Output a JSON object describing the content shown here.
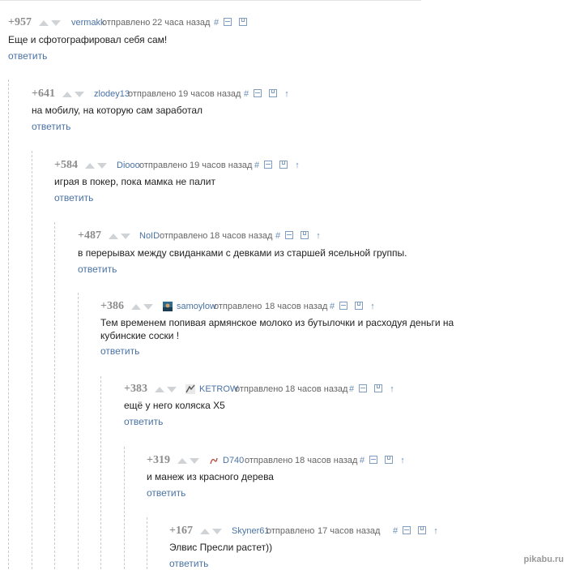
{
  "comments": [
    {
      "rating": "+957",
      "author": "vermakk",
      "sent": "отправлено",
      "time": "22 часа назад",
      "text": "Еще и сфотографировал себя сам!",
      "reply": "ответить",
      "up_arrow": ""
    },
    {
      "rating": "+641",
      "author": "zlodey13",
      "sent": "отправлено",
      "time": "19 часов назад",
      "text": "на мобилу, на которую сам заработал",
      "reply": "ответить",
      "up_arrow": "↑"
    },
    {
      "rating": "+584",
      "author": "Diooo",
      "sent": "отправлено",
      "time": "19 часов назад",
      "text": "играя в покер, пока мамка не палит",
      "reply": "ответить",
      "up_arrow": "↑"
    },
    {
      "rating": "+487",
      "author": "NoID",
      "sent": "отправлено",
      "time": "18 часов назад",
      "text": "в перерывах между свиданками с девками из старшей ясельной группы.",
      "reply": "ответить",
      "up_arrow": "↑"
    },
    {
      "rating": "+386",
      "author": "samoylow",
      "sent": "отправлено",
      "time": "18 часов назад",
      "text": "Тем временем попивая армянское молоко из бутылочки и расходуя деньги на кубинские соски !",
      "reply": "ответить",
      "up_arrow": "↑"
    },
    {
      "rating": "+383",
      "author": "KETROW",
      "sent": "отправлено",
      "time": "18 часов назад",
      "text": "ещё у него коляска X5",
      "reply": "ответить",
      "up_arrow": "↑"
    },
    {
      "rating": "+319",
      "author": "D740",
      "sent": "отправлено",
      "time": "18 часов назад",
      "text": "и манеж из красного дерева",
      "reply": "ответить",
      "up_arrow": "↑"
    },
    {
      "rating": "+167",
      "author": "Skyner61",
      "sent": "отправлено",
      "time": "17 часов назад",
      "text": "Элвис Пресли растет))",
      "reply": "ответить",
      "up_arrow": "↑"
    }
  ],
  "link_symbol": "#",
  "watermark": "pikabu.ru",
  "colors": {
    "link": "#4a72a4",
    "rating": "#8c8c8c",
    "arrow": "#cfd3d6",
    "guide": "#c9c9c9"
  }
}
